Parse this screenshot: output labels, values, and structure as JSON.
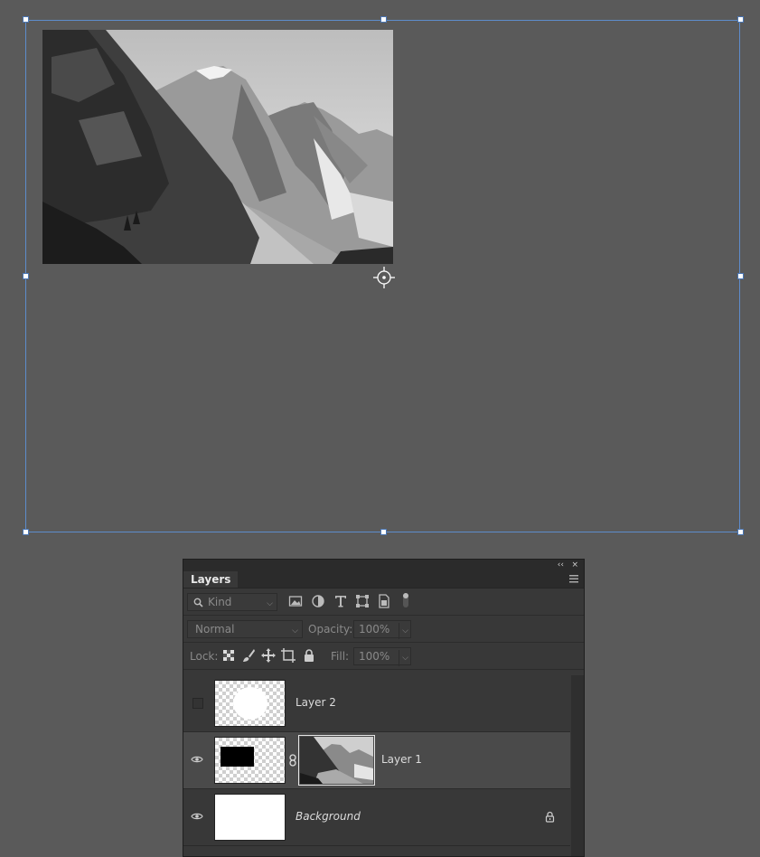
{
  "canvas": {
    "image": "mountain-landscape-grayscale-photo"
  },
  "panel": {
    "strip": {
      "collapse": "‹‹",
      "close": "×"
    },
    "tab": "Layers",
    "filter": {
      "kind": "Kind"
    },
    "blend": {
      "mode": "Normal",
      "opacity_label": "Opacity:",
      "opacity": "100%"
    },
    "lock": {
      "label": "Lock:",
      "fill_label": "Fill:",
      "fill": "100%"
    },
    "layers": [
      {
        "name": "Layer 2",
        "visible": false,
        "italic": false
      },
      {
        "name": "Layer 1",
        "visible": true,
        "italic": false,
        "selected": true
      },
      {
        "name": "Background",
        "visible": true,
        "italic": true,
        "locked": true
      }
    ]
  },
  "colors": {
    "canvas_bg": "#5a5a5a",
    "selection": "#5d8ccb",
    "panel_bg": "#383838",
    "selected_row": "#4a4a4a"
  }
}
